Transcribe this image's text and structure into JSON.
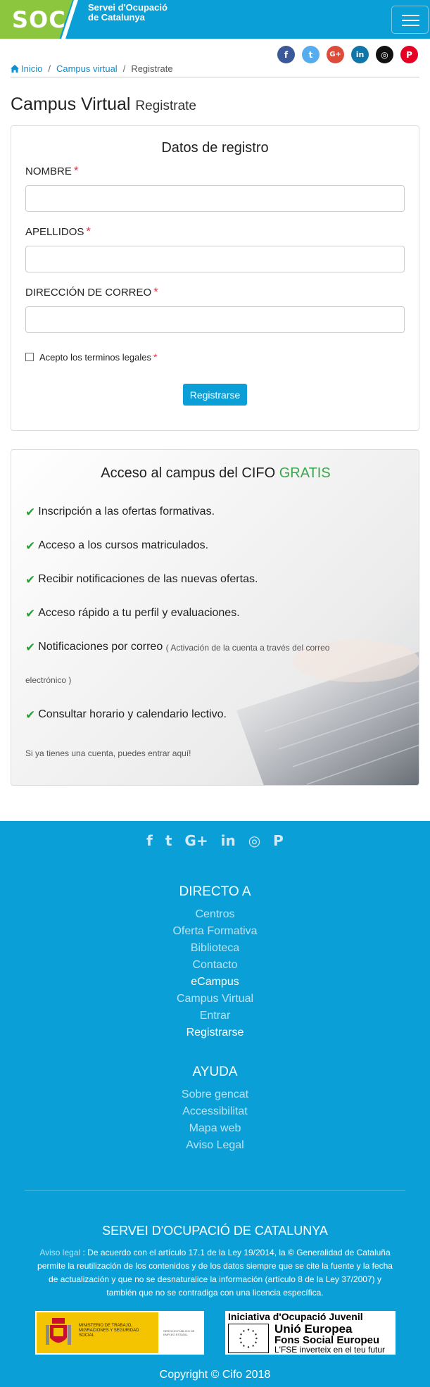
{
  "header": {
    "logo": "SOC",
    "org_line1": "Servei d'Ocupació",
    "org_line2": "de Catalunya"
  },
  "social_top": [
    {
      "name": "facebook",
      "glyph": "f",
      "color": "#3b5998"
    },
    {
      "name": "twitter",
      "glyph": "t",
      "color": "#55acee"
    },
    {
      "name": "google-plus",
      "glyph": "G+",
      "color": "#dd4b39"
    },
    {
      "name": "linkedin",
      "glyph": "in",
      "color": "#0e76a8"
    },
    {
      "name": "instagram",
      "glyph": "◎",
      "color": "#111111"
    },
    {
      "name": "pinterest",
      "glyph": "P",
      "color": "#e60023"
    }
  ],
  "breadcrumb": {
    "home": "Inicio",
    "campus": "Campus virtual",
    "current": "Registrate"
  },
  "page_title": {
    "main": "Campus Virtual",
    "sub": "Registrate"
  },
  "form": {
    "title": "Datos de registro",
    "nombre_label": "NOMBRE",
    "apellidos_label": "APELLIDOS",
    "correo_label": "DIRECCIÓN DE CORREO",
    "required_mark": "*",
    "terms_label": "Acepto los terminos legales",
    "submit_label": "Registrarse"
  },
  "access": {
    "title": "Acceso al campus del CIFO",
    "title_highlight": "GRATIS",
    "check": "✔",
    "items": [
      "Inscripción a las ofertas formativas.",
      "Acceso a los cursos matriculados.",
      "Recibir notificaciones de las nuevas ofertas.",
      "Acceso rápido a tu perfil y evaluaciones.",
      "Notificaciones por correo",
      "Consultar horario y calendario lectivo."
    ],
    "item5_note_a": "( Activación de la cuenta a través del correo",
    "item5_note_b": "electrónico )",
    "login_hint": "Si ya tienes una cuenta, puedes entrar aquí!"
  },
  "footer": {
    "social": [
      "f",
      "t",
      "G+",
      "in",
      "◎",
      "P"
    ],
    "directo_heading": "DIRECTO A",
    "directo_links": [
      "Centros",
      "Oferta Formativa",
      "Biblioteca",
      "Contacto",
      "eCampus",
      "Campus Virtual",
      "Entrar",
      "Registrarse"
    ],
    "ayuda_heading": "AYUDA",
    "ayuda_links": [
      "Sobre gencat",
      "Accessibilitat",
      "Mapa web",
      "Aviso Legal"
    ],
    "org_name": "SERVEI D'OCUPACIÓ DE CATALUNYA",
    "legal_link": "Aviso legal",
    "legal_text": ": De acuerdo con el artículo 17.1 de la Ley 19/2014, la © Generalidad de Cataluña permite la reutilización de los contenidos y de los datos siempre que se cite la fuente y la fecha de actualización y que no se desnaturalice la información (artículo 8 de la Ley 37/2007) y también que no se contradiga con una licencia específica.",
    "gov_logo_text": "MINISTERIO DE TRABAJO, MIGRACIONES Y SEGURIDAD SOCIAL",
    "sepe_text": "SERVICIO PÚBLICO DE EMPLEO ESTATAL",
    "eu_line1": "Iniciativa d'Ocupació Juvenil",
    "eu_line2": "Unió Europea",
    "eu_line3": "Fons Social Europeu",
    "eu_line4": "L'FSE inverteix en el teu futur",
    "copyright": "Copyright © Cifo 2018"
  }
}
